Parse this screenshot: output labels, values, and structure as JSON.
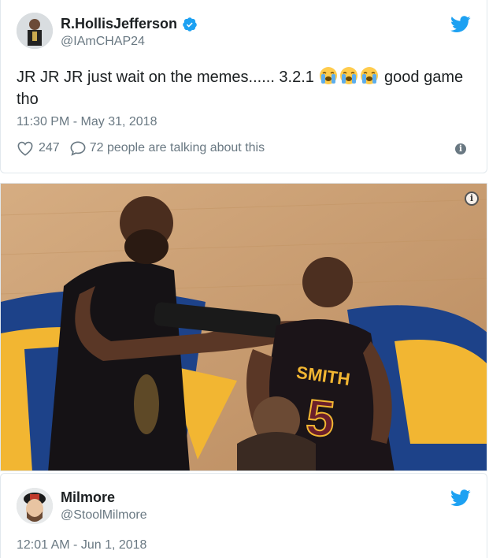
{
  "tweet1": {
    "display_name": "R.HollisJefferson",
    "handle": "@IAmCHAP24",
    "text_before": "JR JR JR just wait on the memes...... 3.2.1",
    "emojis": [
      "loudly-crying-face",
      "loudly-crying-face",
      "loudly-crying-face"
    ],
    "text_after": "good game tho",
    "timestamp": "11:30 PM - May 31, 2018",
    "likes": "247",
    "talking": "72 people are talking about this",
    "icons": {
      "verified": "verified-badge-icon",
      "bird": "twitter-bird-icon",
      "like": "heart-icon",
      "reply": "speech-bubble-icon",
      "info": "info-icon"
    }
  },
  "media": {
    "jersey_name": "SMITH",
    "jersey_number": "5"
  },
  "tweet2": {
    "display_name": "Milmore",
    "handle": "@StoolMilmore",
    "timestamp": "12:01 AM - Jun 1, 2018",
    "icons": {
      "bird": "twitter-bird-icon"
    }
  },
  "colors": {
    "twitter_blue": "#1da1f2",
    "text_primary": "#1c2022",
    "text_secondary": "#697882",
    "border": "#e1e8ed"
  }
}
